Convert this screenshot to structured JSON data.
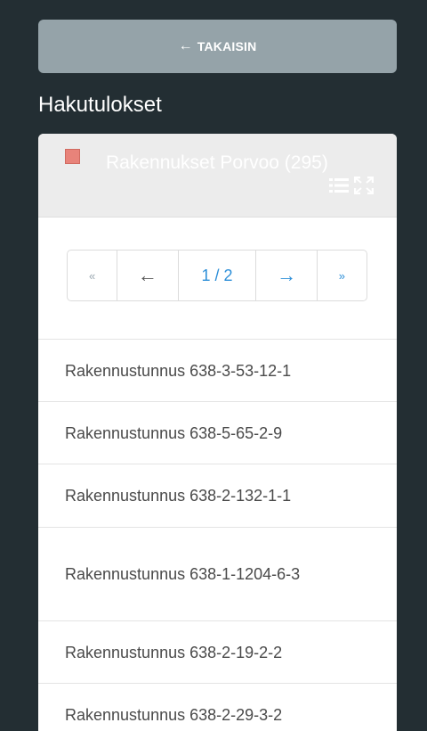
{
  "back_button": {
    "label": "TAKAISIN",
    "icon": "arrow-left-icon"
  },
  "results_title": "Hakutulokset",
  "layer": {
    "name": "Rakennukset Porvoo (295)",
    "swatch_color": "#e8837a"
  },
  "pager": {
    "first": "«",
    "prev": "←",
    "current": "1 / 2",
    "next": "→",
    "last": "»"
  },
  "results": [
    "Rakennustunnus 638-3-53-12-1",
    "Rakennustunnus 638-5-65-2-9",
    "Rakennustunnus 638-2-132-1-1",
    "Rakennustunnus 638-1-1204-6-3",
    "Rakennustunnus 638-2-19-2-2",
    "Rakennustunnus 638-2-29-3-2"
  ]
}
